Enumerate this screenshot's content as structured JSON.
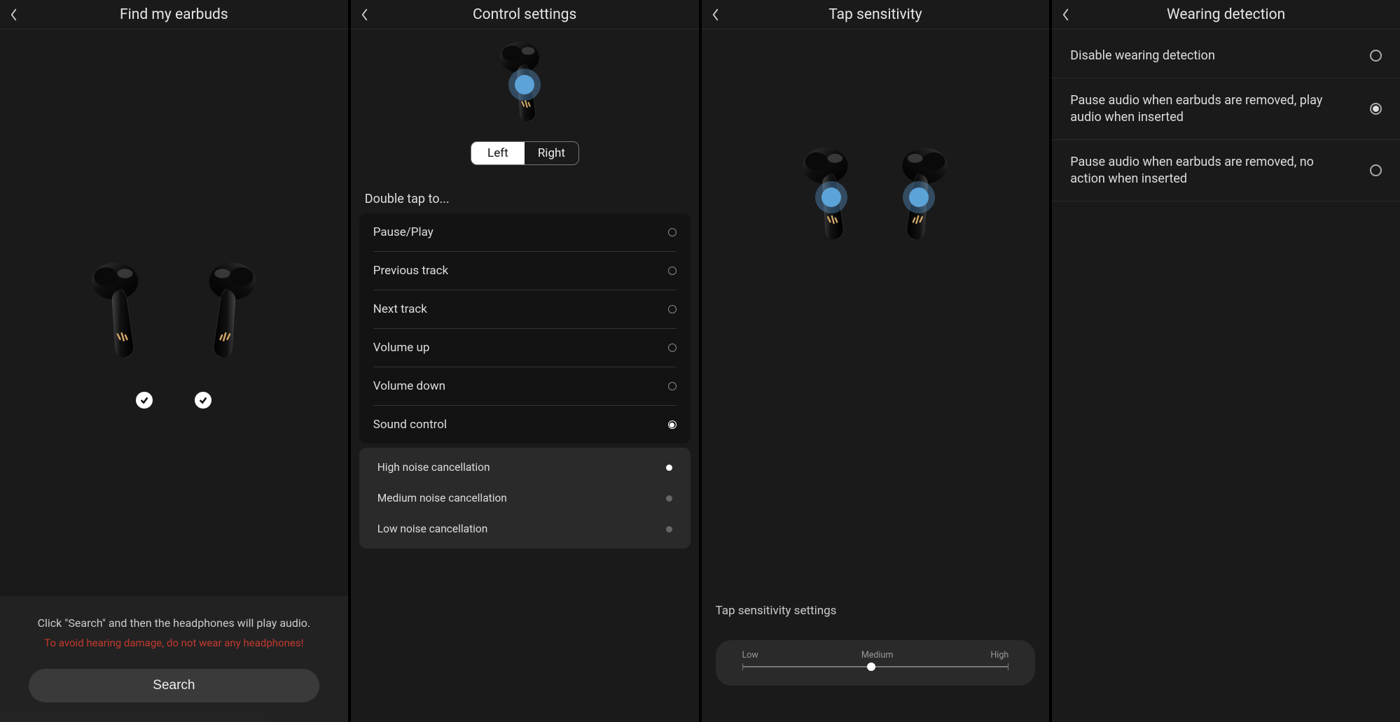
{
  "panel1": {
    "title": "Find my earbuds",
    "info": "Click \"Search\" and then the headphones will play audio.",
    "warning": "To avoid hearing damage, do not wear any headphones!",
    "search_btn": "Search"
  },
  "panel2": {
    "title": "Control settings",
    "seg_left": "Left",
    "seg_right": "Right",
    "seg_selected": "Left",
    "section": "Double tap to...",
    "options": [
      {
        "label": "Pause/Play",
        "selected": false
      },
      {
        "label": "Previous track",
        "selected": false
      },
      {
        "label": "Next track",
        "selected": false
      },
      {
        "label": "Volume up",
        "selected": false
      },
      {
        "label": "Volume down",
        "selected": false
      },
      {
        "label": "Sound control",
        "selected": true
      }
    ],
    "sound_sub": [
      {
        "label": "High noise  cancellation",
        "selected": true
      },
      {
        "label": "Medium noise cancellation",
        "selected": false
      },
      {
        "label": "Low noise   cancellation",
        "selected": false
      }
    ]
  },
  "panel3": {
    "title": "Tap sensitivity",
    "label": "Tap sensitivity settings",
    "slider_low": "Low",
    "slider_medium": "Medium",
    "slider_high": "High",
    "slider_value": "Medium"
  },
  "panel4": {
    "title": "Wearing detection",
    "options": [
      {
        "label": "Disable wearing detection",
        "selected": false
      },
      {
        "label": "Pause audio when earbuds are removed, play audio when inserted",
        "selected": true
      },
      {
        "label": "Pause audio when earbuds are removed, no action when inserted",
        "selected": false
      }
    ]
  }
}
